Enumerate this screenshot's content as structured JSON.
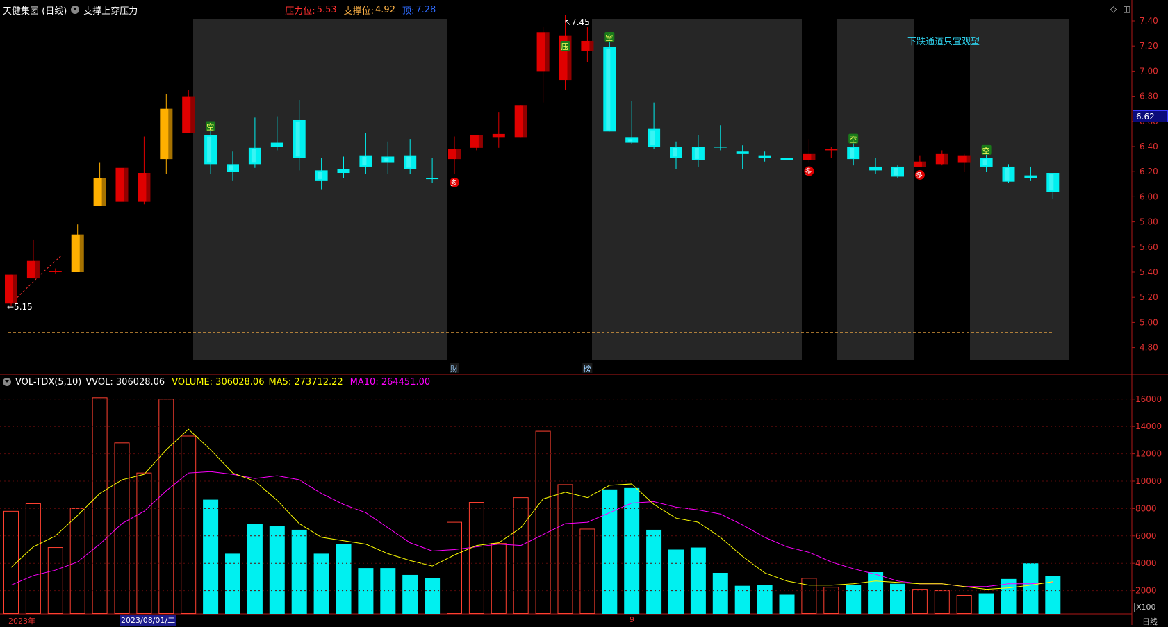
{
  "header": {
    "stock_name": "天健集团 (日线)",
    "indicator_name": "支撑上穿压力",
    "resistance_label": "压力位:",
    "resistance_value": "5.53",
    "support_label": "支撑位:",
    "support_value": "4.92",
    "top_label": "顶:",
    "top_value": "7.28",
    "icons": [
      "diamond-icon",
      "window-icon"
    ]
  },
  "volume_header": {
    "name": "VOL-TDX(5,10)",
    "vvol": "VVOL: 306028.06",
    "volume": "VOLUME: 306028.06",
    "ma5": "MA5: 273712.22",
    "ma10": "MA10: 264451.00"
  },
  "annotations": {
    "high_label": "7.45",
    "low_label": "5.15",
    "channel_note": "下跌通道只宜观望",
    "event_cai": "财",
    "event_bang": "榜",
    "signal_kong": "空",
    "signal_ya": "压",
    "signal_duo": "多"
  },
  "current_price": "6.62",
  "bottom": {
    "year": "2023年",
    "date": "2023/08/01/二",
    "month": "9",
    "multiplier": "X100",
    "period": "日线"
  },
  "colors": {
    "up": "#e00000",
    "down": "#00f0f0",
    "gold": "#ffb000",
    "ma5": "#ffff00",
    "ma10": "#ff00ff",
    "shade": "#262626",
    "resistance": "#ff3030",
    "support": "#ffb347",
    "top": "#2e6bff"
  },
  "chart_data": [
    {
      "type": "candlestick",
      "y_axis_ticks": [
        "7.40",
        "7.20",
        "7.00",
        "6.80",
        "6.60",
        "6.40",
        "6.20",
        "6.00",
        "5.80",
        "5.60",
        "5.40",
        "5.20",
        "5.00",
        "4.80"
      ],
      "ylim": [
        4.72,
        7.48
      ],
      "resistance_line": 5.53,
      "support_line": 4.92,
      "candles": [
        {
          "o": 5.38,
          "c": 5.15,
          "h": 5.38,
          "l": 5.13,
          "k": "up"
        },
        {
          "o": 5.35,
          "c": 5.49,
          "h": 5.66,
          "l": 5.35,
          "k": "up"
        },
        {
          "o": 5.4,
          "c": 5.41,
          "h": 5.43,
          "l": 5.39,
          "k": "cross"
        },
        {
          "o": 5.4,
          "c": 5.7,
          "h": 5.78,
          "l": 5.4,
          "k": "gold"
        },
        {
          "o": 5.93,
          "c": 6.15,
          "h": 6.27,
          "l": 5.93,
          "k": "gold"
        },
        {
          "o": 5.96,
          "c": 6.23,
          "h": 6.25,
          "l": 5.94,
          "k": "up"
        },
        {
          "o": 5.96,
          "c": 6.19,
          "h": 6.48,
          "l": 5.94,
          "k": "up"
        },
        {
          "o": 6.3,
          "c": 6.7,
          "h": 6.82,
          "l": 6.18,
          "k": "gold"
        },
        {
          "o": 6.51,
          "c": 6.8,
          "h": 6.85,
          "l": 6.51,
          "k": "up"
        },
        {
          "o": 6.49,
          "c": 6.26,
          "h": 6.53,
          "l": 6.18,
          "k": "down"
        },
        {
          "o": 6.26,
          "c": 6.2,
          "h": 6.36,
          "l": 6.13,
          "k": "down"
        },
        {
          "o": 6.39,
          "c": 6.26,
          "h": 6.63,
          "l": 6.23,
          "k": "down"
        },
        {
          "o": 6.43,
          "c": 6.4,
          "h": 6.64,
          "l": 6.37,
          "k": "down"
        },
        {
          "o": 6.61,
          "c": 6.31,
          "h": 6.77,
          "l": 6.21,
          "k": "down"
        },
        {
          "o": 6.21,
          "c": 6.13,
          "h": 6.31,
          "l": 6.06,
          "k": "down"
        },
        {
          "o": 6.22,
          "c": 6.19,
          "h": 6.32,
          "l": 6.15,
          "k": "down"
        },
        {
          "o": 6.33,
          "c": 6.24,
          "h": 6.51,
          "l": 6.18,
          "k": "down"
        },
        {
          "o": 6.32,
          "c": 6.27,
          "h": 6.44,
          "l": 6.18,
          "k": "down"
        },
        {
          "o": 6.33,
          "c": 6.22,
          "h": 6.46,
          "l": 6.18,
          "k": "down"
        },
        {
          "o": 6.15,
          "c": 6.14,
          "h": 6.31,
          "l": 6.11,
          "k": "down"
        },
        {
          "o": 6.3,
          "c": 6.38,
          "h": 6.48,
          "l": 6.18,
          "k": "up"
        },
        {
          "o": 6.39,
          "c": 6.49,
          "h": 6.49,
          "l": 6.37,
          "k": "up"
        },
        {
          "o": 6.47,
          "c": 6.5,
          "h": 6.67,
          "l": 6.39,
          "k": "up"
        },
        {
          "o": 6.47,
          "c": 6.73,
          "h": 6.73,
          "l": 6.47,
          "k": "up"
        },
        {
          "o": 7.0,
          "c": 7.31,
          "h": 7.35,
          "l": 6.75,
          "k": "up"
        },
        {
          "o": 6.93,
          "c": 7.28,
          "h": 7.45,
          "l": 6.85,
          "k": "up"
        },
        {
          "o": 7.16,
          "c": 7.24,
          "h": 7.35,
          "l": 7.07,
          "k": "up"
        },
        {
          "o": 7.19,
          "c": 6.52,
          "h": 7.24,
          "l": 6.52,
          "k": "down"
        },
        {
          "o": 6.47,
          "c": 6.43,
          "h": 6.76,
          "l": 6.42,
          "k": "down"
        },
        {
          "o": 6.54,
          "c": 6.4,
          "h": 6.75,
          "l": 6.38,
          "k": "down"
        },
        {
          "o": 6.4,
          "c": 6.31,
          "h": 6.44,
          "l": 6.22,
          "k": "down"
        },
        {
          "o": 6.4,
          "c": 6.29,
          "h": 6.49,
          "l": 6.24,
          "k": "down"
        },
        {
          "o": 6.4,
          "c": 6.4,
          "h": 6.57,
          "l": 6.37,
          "k": "cross_down"
        },
        {
          "o": 6.36,
          "c": 6.34,
          "h": 6.41,
          "l": 6.22,
          "k": "down"
        },
        {
          "o": 6.33,
          "c": 6.31,
          "h": 6.36,
          "l": 6.28,
          "k": "down"
        },
        {
          "o": 6.31,
          "c": 6.29,
          "h": 6.38,
          "l": 6.27,
          "k": "down"
        },
        {
          "o": 6.29,
          "c": 6.34,
          "h": 6.46,
          "l": 6.27,
          "k": "up"
        },
        {
          "o": 6.37,
          "c": 6.38,
          "h": 6.4,
          "l": 6.31,
          "k": "cross"
        },
        {
          "o": 6.4,
          "c": 6.3,
          "h": 6.43,
          "l": 6.25,
          "k": "down"
        },
        {
          "o": 6.24,
          "c": 6.21,
          "h": 6.31,
          "l": 6.18,
          "k": "down"
        },
        {
          "o": 6.24,
          "c": 6.16,
          "h": 6.25,
          "l": 6.15,
          "k": "down"
        },
        {
          "o": 6.24,
          "c": 6.28,
          "h": 6.33,
          "l": 6.24,
          "k": "up"
        },
        {
          "o": 6.26,
          "c": 6.34,
          "h": 6.37,
          "l": 6.25,
          "k": "up"
        },
        {
          "o": 6.27,
          "c": 6.33,
          "h": 6.34,
          "l": 6.2,
          "k": "up"
        },
        {
          "o": 6.31,
          "c": 6.24,
          "h": 6.34,
          "l": 6.2,
          "k": "down"
        },
        {
          "o": 6.24,
          "c": 6.12,
          "h": 6.26,
          "l": 6.11,
          "k": "down"
        },
        {
          "o": 6.17,
          "c": 6.15,
          "h": 6.24,
          "l": 6.13,
          "k": "down"
        },
        {
          "o": 6.19,
          "c": 6.04,
          "h": 6.19,
          "l": 5.98,
          "k": "down"
        }
      ]
    },
    {
      "type": "bar",
      "y_axis_ticks": [
        "16000",
        "14000",
        "12000",
        "10000",
        "8000",
        "6000",
        "4000",
        "2000"
      ],
      "ylim": [
        0,
        16500
      ],
      "volumes": [
        7800,
        8350,
        5150,
        8000,
        16100,
        12800,
        10600,
        16000,
        13300,
        8650,
        4700,
        6900,
        6700,
        6450,
        4700,
        5400,
        3650,
        3650,
        3150,
        2900,
        7000,
        8450,
        5450,
        8800,
        13650,
        9750,
        6500,
        9400,
        9500,
        6450,
        5000,
        5150,
        3300,
        2350,
        2400,
        1700,
        2900,
        2250,
        2400,
        3350,
        2500,
        2100,
        2000,
        1650,
        1800,
        2850,
        4000,
        3050
      ],
      "ma5": [
        3700,
        5200,
        6000,
        7500,
        9100,
        10100,
        10500,
        12300,
        13800,
        12300,
        10600,
        10000,
        8600,
        6900,
        5900,
        5650,
        5400,
        4700,
        4200,
        3800,
        4600,
        5300,
        5500,
        6600,
        8700,
        9200,
        8800,
        9700,
        9800,
        8300,
        7300,
        7000,
        5900,
        4500,
        3300,
        2700,
        2400,
        2400,
        2500,
        2700,
        2600,
        2500,
        2500,
        2300,
        2100,
        2200,
        2400,
        2650
      ],
      "ma10": [
        2400,
        3100,
        3500,
        4100,
        5400,
        6900,
        7800,
        9300,
        10600,
        10700,
        10500,
        10200,
        10400,
        10100,
        9100,
        8300,
        7700,
        6600,
        5500,
        4900,
        5000,
        5200,
        5400,
        5300,
        6100,
        6900,
        7000,
        7700,
        8400,
        8500,
        8100,
        7900,
        7600,
        6800,
        5900,
        5200,
        4800,
        4100,
        3600,
        3200,
        2700,
        2500,
        2500,
        2300,
        2300,
        2500,
        2500,
        2600
      ]
    }
  ]
}
